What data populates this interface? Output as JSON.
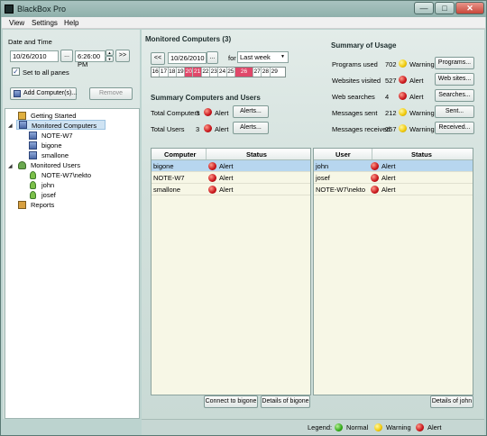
{
  "app": {
    "title": "BlackBox Pro"
  },
  "window_controls": {
    "minimize": "—",
    "maximize": "□",
    "close": "✕"
  },
  "menu": {
    "items": [
      "View",
      "Settings",
      "Help"
    ]
  },
  "left": {
    "date_time_label": "Date and Time",
    "date_value": "10/26/2010",
    "date_picker": "...",
    "time_value": "6:26:00 PM",
    "spin_up": "▲",
    "spin_down": "▼",
    "forward": ">>",
    "set_all_label": "Set to all panes",
    "set_all_checked": "✓",
    "add_computers": "Add Computer(s)...",
    "remove": "Remove",
    "tree": {
      "getting_started": "Getting Started",
      "monitored_computers": "Monitored Computers",
      "computers": [
        "NOTE-W7",
        "bigone",
        "smallone"
      ],
      "monitored_users": "Monitored Users",
      "users": [
        "NOTE-W7\\nekto",
        "john",
        "josef"
      ],
      "reports": "Reports"
    }
  },
  "main": {
    "monitored_title": "Monitored Computers (3)",
    "back": "<<",
    "date_value": "10/26/2010",
    "date_picker": "...",
    "for_label": "for",
    "period_value": "Last week",
    "dropdown_arrow": "▼",
    "calendar_days": [
      "16",
      "17",
      "18",
      "19",
      "20",
      "21",
      "22",
      "23",
      "24",
      "25",
      "26",
      "27",
      "28",
      "29"
    ],
    "summary_cu_title": "Summary Computers and Users",
    "total_computers_label": "Total Computers",
    "total_computers_value": "3",
    "total_computers_status": "Alert",
    "total_computers_btn": "Alerts...",
    "total_users_label": "Total Users",
    "total_users_value": "3",
    "total_users_status": "Alert",
    "total_users_btn": "Alerts...",
    "usage_title": "Summary of Usage",
    "usage": [
      {
        "label": "Programs used",
        "value": "702",
        "status": "Warning",
        "btn": "Programs..."
      },
      {
        "label": "Websites visited",
        "value": "527",
        "status": "Alert",
        "btn": "Web sites..."
      },
      {
        "label": "Web searches",
        "value": "4",
        "status": "Alert",
        "btn": "Searches..."
      },
      {
        "label": "Messages sent",
        "value": "212",
        "status": "Warning",
        "btn": "Sent..."
      },
      {
        "label": "Messages received",
        "value": "257",
        "status": "Warning",
        "btn": "Received..."
      }
    ],
    "computers_grid": {
      "headers": [
        "Computer",
        "Status"
      ],
      "rows": [
        {
          "name": "bigone",
          "status": "Alert"
        },
        {
          "name": "NOTE-W7",
          "status": "Alert"
        },
        {
          "name": "smallone",
          "status": "Alert"
        }
      ]
    },
    "users_grid": {
      "headers": [
        "User",
        "Status"
      ],
      "rows": [
        {
          "name": "john",
          "status": "Alert"
        },
        {
          "name": "josef",
          "status": "Alert"
        },
        {
          "name": "NOTE-W7\\nekto",
          "status": "Alert"
        }
      ]
    },
    "connect_btn": "Connect to bigone",
    "details_computer_btn": "Details of bigone",
    "details_user_btn": "Details of john"
  },
  "legend": {
    "label": "Legend:",
    "normal": "Normal",
    "warning": "Warning",
    "alert": "Alert"
  },
  "colors": {
    "alert": "#c8141a",
    "warning": "#f0c808",
    "normal": "#30a818",
    "calendar_highlight": "#e0486a"
  }
}
